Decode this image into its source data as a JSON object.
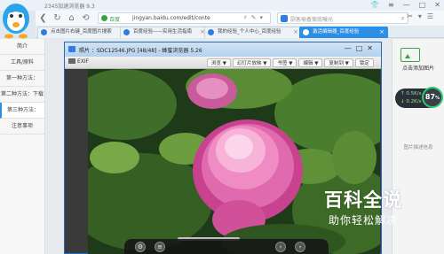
{
  "browser": {
    "title": "2345加速浏览器 9.3",
    "secure_label": "百度",
    "url": "jingyan.baidu.com/edit/conte",
    "search_placeholder": "厨客偷香案底曝光",
    "brand_color": "#2b8fe5"
  },
  "tabs": [
    {
      "label": "点击图片右键_百度图片搜索"
    },
    {
      "label": "百度经验——实用生活指南"
    },
    {
      "label": "我的经验_个人中心_百度经验"
    },
    {
      "label": "激活编辑器_百度经验",
      "active": true
    }
  ],
  "sidebar": {
    "items": [
      {
        "label": "简介"
      },
      {
        "label": "工具/原料"
      },
      {
        "label": "第一种方法："
      },
      {
        "label": "第二种方法：下载"
      },
      {
        "label": "第三种方法："
      },
      {
        "label": "注意事项"
      }
    ]
  },
  "viewer": {
    "title": "照片 ：SDC12546.JPG [48/48] - 蜂蜜浏览器 5.26",
    "exif_label": "EXIF",
    "menu": [
      "浏览 ▼",
      "幻灯片放映 ▼",
      "书签 ▼",
      "编辑 ▼",
      "复制到 ▼",
      "锁定"
    ]
  },
  "right_panel": {
    "add_image_label": "点击添加图片",
    "mem_line1": "0.5",
    "mem_line1_unit": "K/s",
    "mem_line2": "0.2",
    "mem_line2_unit": "K/s",
    "mem_percent": "87",
    "mem_percent_unit": "%",
    "image_desc_label": "图片描述信息"
  },
  "overlay": {
    "title": "百科全说",
    "subtitle": "助你轻松解决"
  }
}
